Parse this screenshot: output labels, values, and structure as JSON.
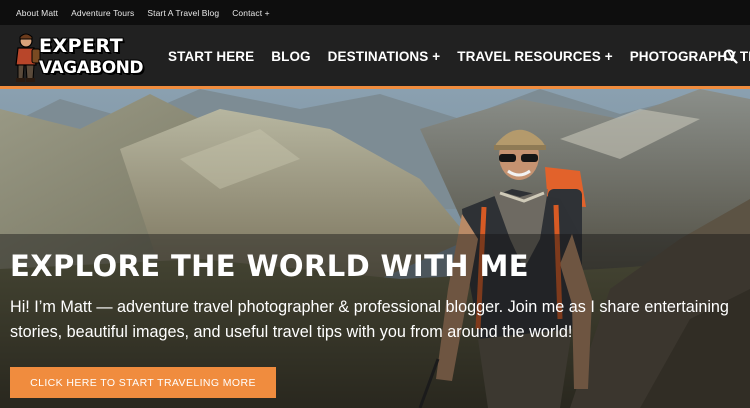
{
  "topbar": {
    "links": [
      "About Matt",
      "Adventure Tours",
      "Start A Travel Blog",
      "Contact +"
    ]
  },
  "logo": {
    "line1": "EXPERT",
    "line2": "VAGABOND"
  },
  "nav": {
    "items": [
      "START HERE",
      "BLOG",
      "DESTINATIONS +",
      "TRAVEL RESOURCES +",
      "PHOTOGRAPHY TIPS +"
    ],
    "search_icon": "search-icon"
  },
  "hero": {
    "title": "EXPLORE THE WORLD WITH ME",
    "subtitle": "Hi! I’m Matt — adventure travel photographer & professional blogger. Join me as I share entertaining stories, beautiful images, and useful travel tips with you from around the world!",
    "cta": "CLICK HERE TO START TRAVELING MORE"
  },
  "colors": {
    "accent": "#f08c3e",
    "nav_bg": "#212121",
    "topbar_bg": "#0e0e0e"
  }
}
